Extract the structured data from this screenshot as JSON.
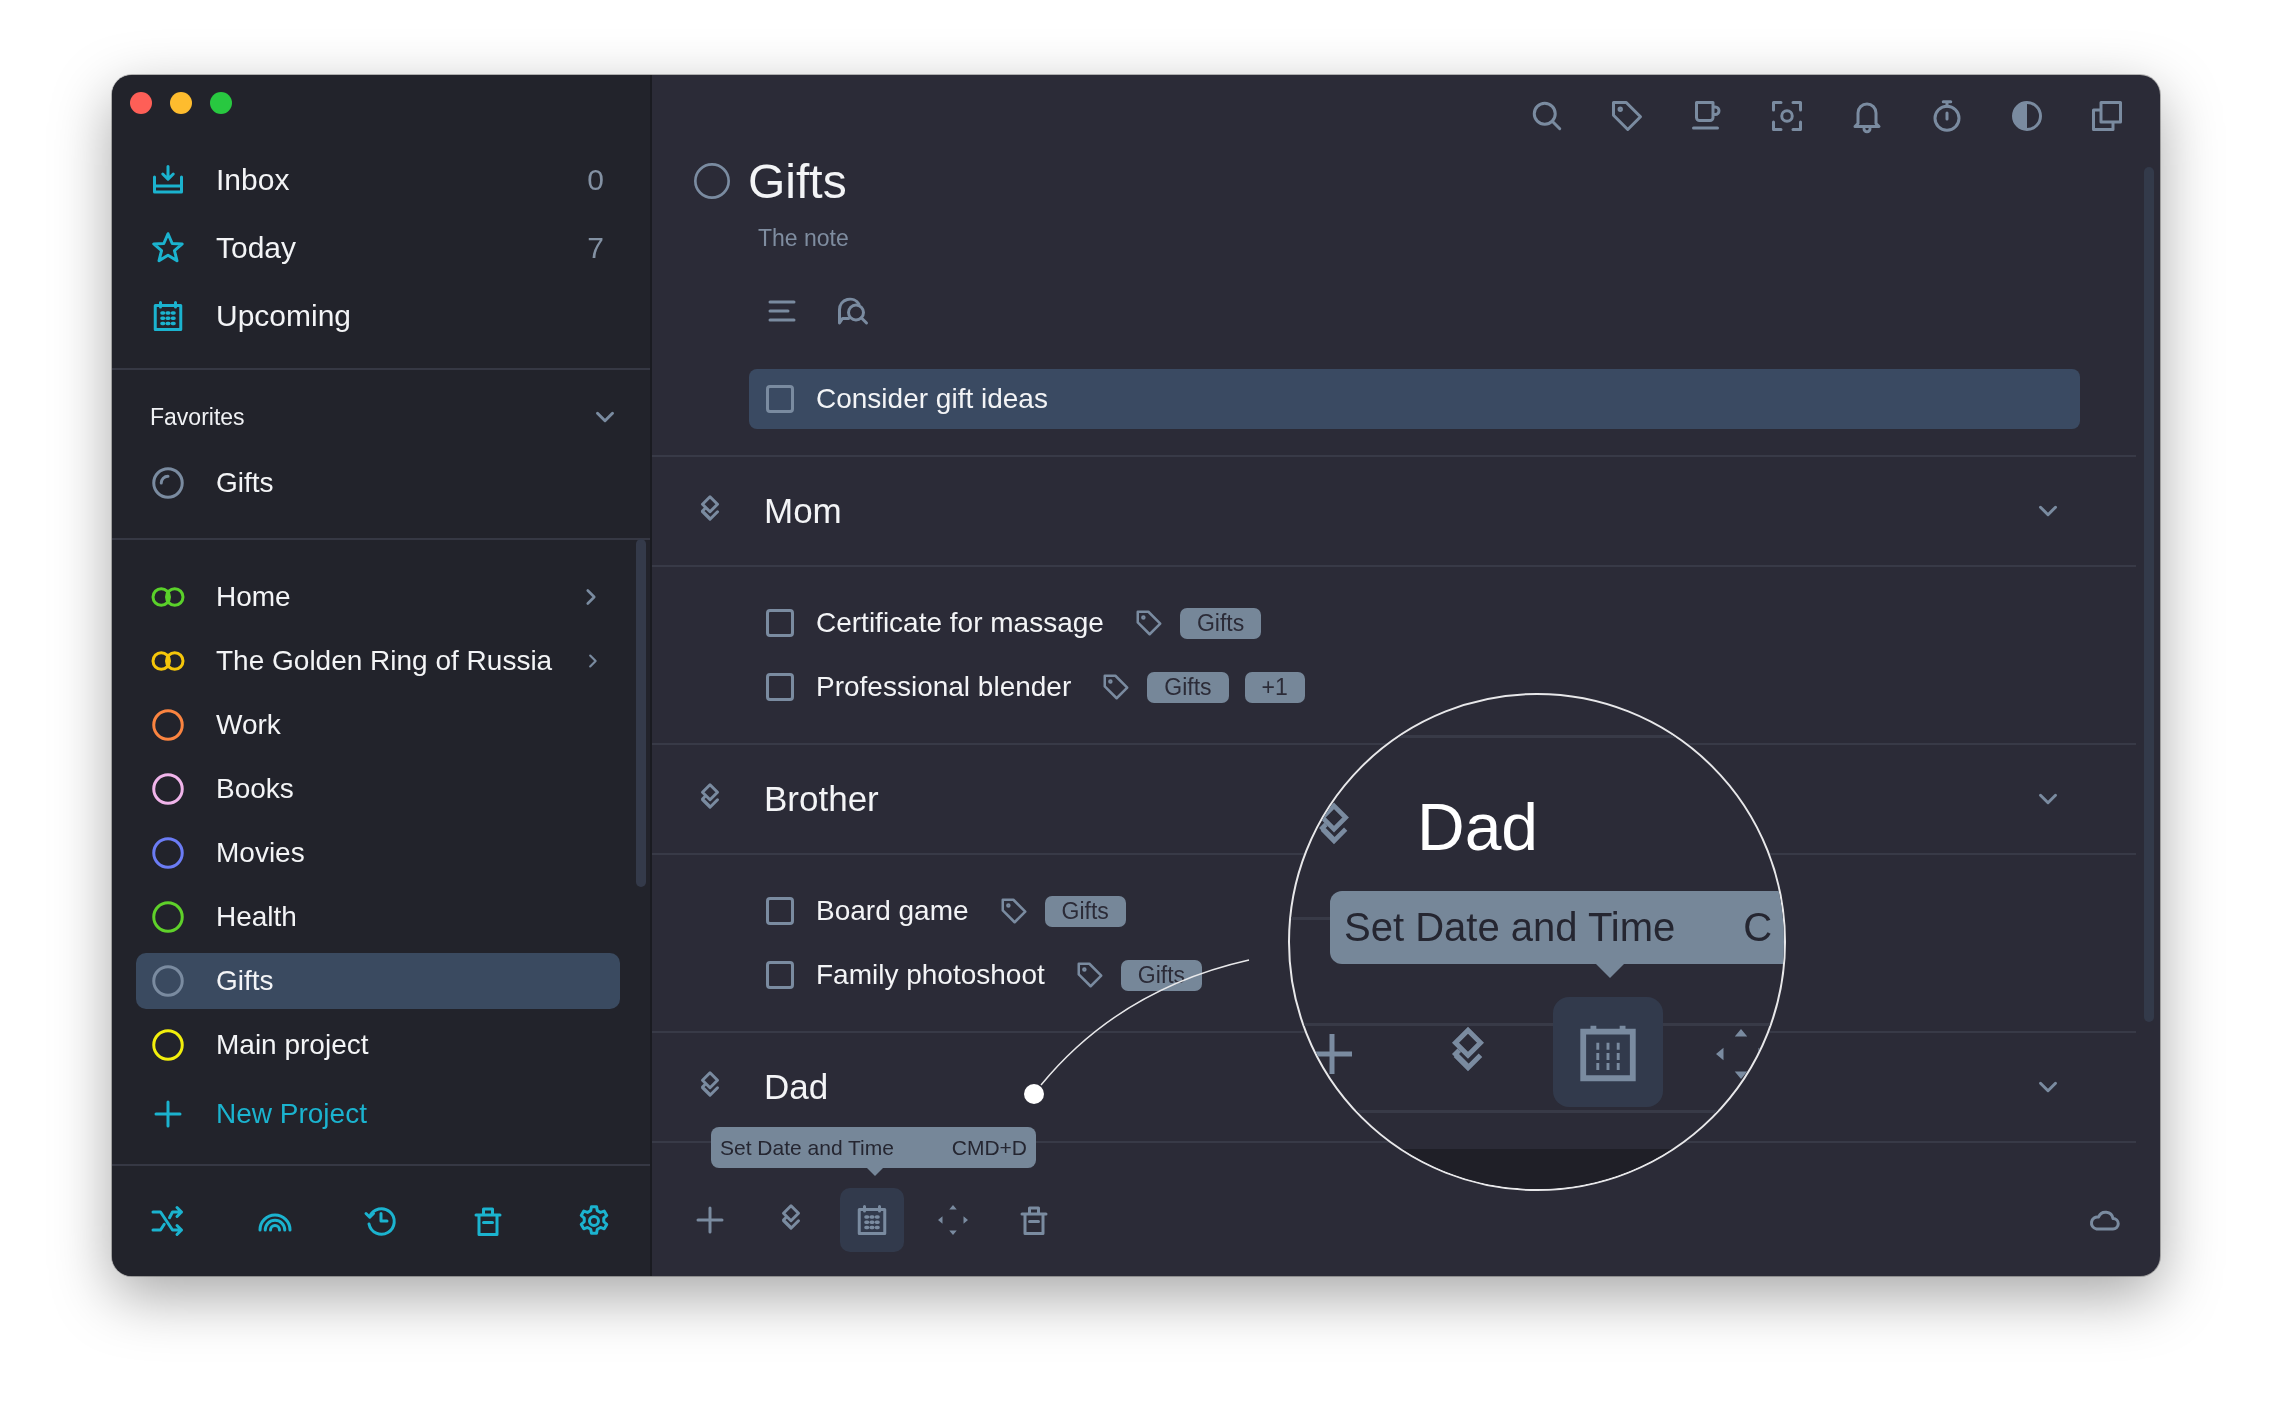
{
  "sidebar": {
    "smart_lists": [
      {
        "kind": "inbox",
        "label": "Inbox",
        "count": "0"
      },
      {
        "kind": "today",
        "label": "Today",
        "count": "7"
      },
      {
        "kind": "upcoming",
        "label": "Upcoming"
      }
    ],
    "favorites": {
      "heading": "Favorites",
      "expanded": true,
      "items": [
        {
          "kind": "progress",
          "label": "Gifts",
          "color": "#7a8ba0"
        }
      ]
    },
    "projects": [
      {
        "kind": "area",
        "label": "Home",
        "color": "#5ad12a",
        "selected": false
      },
      {
        "kind": "area",
        "label": "The Golden Ring of Russia",
        "color": "#f5c60a",
        "selected": false
      },
      {
        "kind": "project",
        "label": "Work",
        "color": "#fb8440",
        "selected": false
      },
      {
        "kind": "project",
        "label": "Books",
        "color": "#f0b4ea",
        "selected": false
      },
      {
        "kind": "project",
        "label": "Movies",
        "color": "#6b7cf5",
        "selected": false
      },
      {
        "kind": "project",
        "label": "Health",
        "color": "#5fd12a",
        "selected": false
      },
      {
        "kind": "project",
        "label": "Gifts",
        "color": "#7a8ba0",
        "selected": true
      },
      {
        "kind": "project",
        "label": "Main project",
        "color": "#f2ef0c",
        "selected": false
      }
    ],
    "new_project": "New Project"
  },
  "main": {
    "title": "Gifts",
    "note": "The note",
    "tasks": [
      {
        "label": "Consider gift ideas",
        "selected": true
      }
    ],
    "sections": [
      {
        "title": "Mom",
        "expanded": true,
        "tasks": [
          {
            "label": "Certificate for massage",
            "selected": false,
            "tags": [
              "Gifts"
            ]
          },
          {
            "label": "Professional blender",
            "selected": false,
            "tags": [
              "Gifts",
              "+1"
            ]
          }
        ]
      },
      {
        "title": "Brother",
        "expanded": true,
        "tasks": [
          {
            "label": "Board game",
            "selected": false,
            "tags": [
              "Gifts"
            ]
          },
          {
            "label": "Family photoshoot",
            "selected": false,
            "tags": [
              "Gifts"
            ]
          }
        ]
      },
      {
        "title": "Dad",
        "expanded": true
      }
    ],
    "toolbar": [
      {
        "kind": "add",
        "selected": false
      },
      {
        "kind": "stack",
        "selected": false
      },
      {
        "kind": "calendar",
        "selected": true
      },
      {
        "kind": "move",
        "selected": false
      },
      {
        "kind": "trash",
        "selected": false
      }
    ],
    "tooltip": {
      "label": "Set Date and Time",
      "shortcut": "CMD+D"
    }
  },
  "magnifier": {
    "heading": "Dad",
    "tooltip_label": "Set Date and Time",
    "tooltip_shortcut": "C"
  }
}
